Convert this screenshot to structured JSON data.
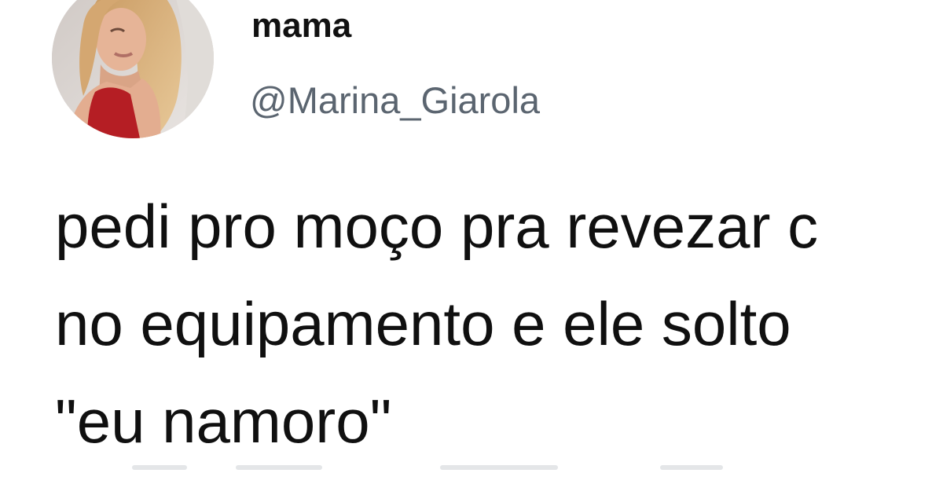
{
  "tweet": {
    "author": {
      "display_name": "mama",
      "handle": "@Marina_Giarola",
      "avatar_icon": "profile-photo"
    },
    "text_lines": [
      "pedi pro moço pra revezar c",
      "no equipamento e ele solto",
      "\"eu namoro\""
    ]
  },
  "colors": {
    "background": "#ffffff",
    "name_text": "#111111",
    "handle_text": "#5b6570",
    "body_text": "#101010"
  }
}
